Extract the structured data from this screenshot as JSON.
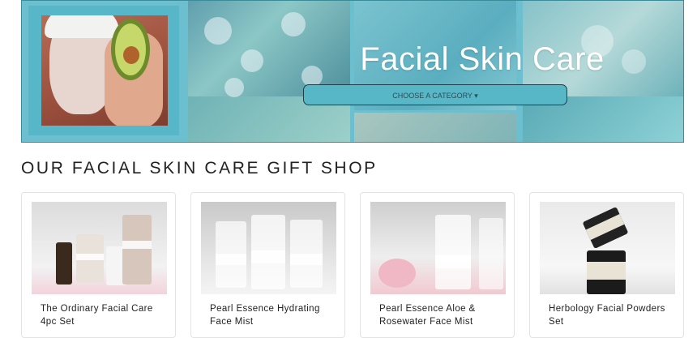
{
  "banner": {
    "title": "Facial Skin Care",
    "category_button": "CHOOSE A CATEGORY ▾"
  },
  "shop": {
    "heading": "OUR FACIAL SKIN CARE GIFT SHOP",
    "products": [
      {
        "name": "The Ordinary Facial Care 4pc Set"
      },
      {
        "name": "Pearl Essence Hydrating Face Mist"
      },
      {
        "name": "Pearl Essence Aloe & Rosewater Face Mist"
      },
      {
        "name": "Herbology Facial Powders Set"
      }
    ]
  },
  "colors": {
    "banner_teal": "#6cbfcf",
    "button_teal": "#58b7c6",
    "heading_text": "#222222"
  }
}
